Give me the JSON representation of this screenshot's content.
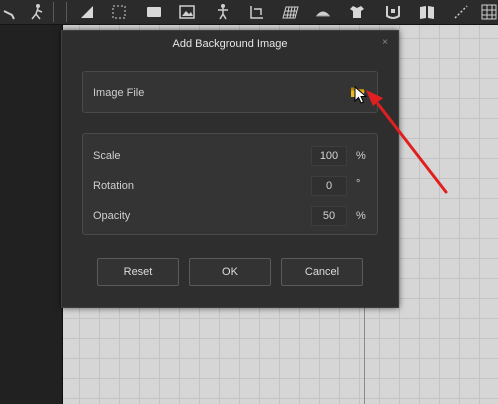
{
  "toolbar": {
    "icons": [
      "tool-icon-1",
      "tool-icon-2",
      "select-triangle-icon",
      "bbox-icon",
      "rectangle-icon",
      "image-icon",
      "transform-icon",
      "grid-paint-icon",
      "mesh-icon",
      "figure-icon",
      "shirt-icon",
      "clamp-icon",
      "book-icon",
      "line-tool-icon",
      "grid-icon"
    ]
  },
  "dialog": {
    "title": "Add Background Image",
    "close_label": "×",
    "image_file": {
      "label": "Image File",
      "browse_icon": "folder-icon"
    },
    "fields": {
      "scale": {
        "label": "Scale",
        "value": "100",
        "unit": "%"
      },
      "rotation": {
        "label": "Rotation",
        "value": "0",
        "unit": "°"
      },
      "opacity": {
        "label": "Opacity",
        "value": "50",
        "unit": "%"
      }
    },
    "buttons": {
      "reset": "Reset",
      "ok": "OK",
      "cancel": "Cancel"
    }
  },
  "colors": {
    "dialog_bg": "#2e2e2e",
    "group_bg": "#343434",
    "annotation_arrow": "#e02020",
    "folder": "#d9a81c",
    "canvas_grid": "#d6d6d6"
  }
}
